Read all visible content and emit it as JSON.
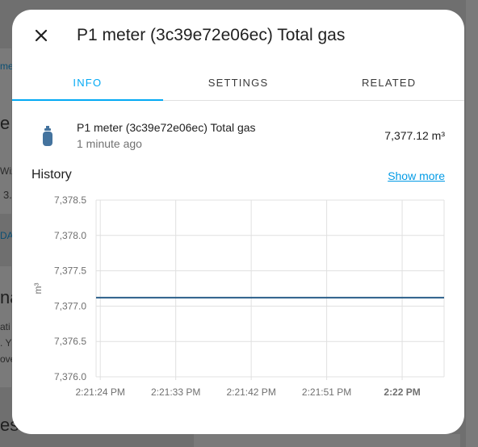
{
  "background": {
    "fragments": [
      "me",
      "e",
      "Wiz",
      "3.",
      "DA",
      "na",
      "ati",
      ". Y",
      "ove",
      "es"
    ]
  },
  "dialog": {
    "title": "P1 meter (3c39e72e06ec) Total gas",
    "close_icon": "close-icon",
    "tabs": [
      {
        "label": "INFO",
        "active": true
      },
      {
        "label": "SETTINGS",
        "active": false
      },
      {
        "label": "RELATED",
        "active": false
      }
    ],
    "entity": {
      "icon": "gas-cylinder-icon",
      "name": "P1 meter (3c39e72e06ec) Total gas",
      "last_changed": "1 minute ago",
      "state": "7,377.12 m³"
    },
    "history": {
      "title": "History",
      "show_more": "Show more"
    }
  },
  "colors": {
    "accent": "#03a9f4",
    "line": "#2b5f8a",
    "grid": "#e0e0e0"
  },
  "chart_data": {
    "type": "line",
    "title": "",
    "xlabel": "",
    "ylabel": "m³",
    "ylim": [
      7376.0,
      7378.5
    ],
    "yticks": [
      "7,376.0",
      "7,376.5",
      "7,377.0",
      "7,377.5",
      "7,378.0",
      "7,378.5"
    ],
    "ytick_values": [
      7376.0,
      7376.5,
      7377.0,
      7377.5,
      7378.0,
      7378.5
    ],
    "xticks": [
      "2:21:24 PM",
      "2:21:33 PM",
      "2:21:42 PM",
      "2:21:51 PM",
      "2:22 PM"
    ],
    "xtick_seconds": [
      24,
      33,
      42,
      51,
      60
    ],
    "xlim_seconds": [
      23.5,
      65
    ],
    "grid": true,
    "series": [
      {
        "x_seconds": [
          23.5,
          65
        ],
        "values": [
          7377.12,
          7377.12
        ]
      }
    ]
  }
}
